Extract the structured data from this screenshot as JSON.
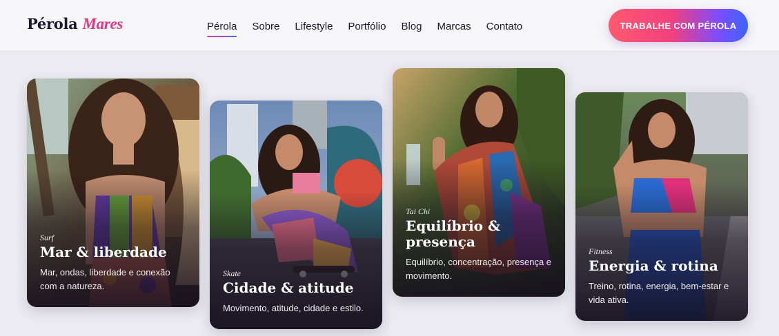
{
  "header": {
    "logo_main": "Pérola",
    "logo_accent": "Mares",
    "nav": [
      {
        "label": "Pérola",
        "active": true
      },
      {
        "label": "Sobre"
      },
      {
        "label": "Lifestyle"
      },
      {
        "label": "Portfólio"
      },
      {
        "label": "Blog"
      },
      {
        "label": "Marcas"
      },
      {
        "label": "Contato"
      }
    ],
    "cta_label": "TRABALHE COM PÉROLA"
  },
  "cards": [
    {
      "category": "Surf",
      "title": "Mar & liberdade",
      "description": "Mar, ondas, liberdade e conexão com a natureza."
    },
    {
      "category": "Skate",
      "title": "Cidade & atitude",
      "description": "Movimento, atitude, cidade e estilo."
    },
    {
      "category": "Tai Chi",
      "title": "Equilíbrio & presença",
      "description": "Equilíbrio, concentração, presença e movimento."
    },
    {
      "category": "Fitness",
      "title": "Energia & rotina",
      "description": "Treino, rotina, energia, bem-estar e vida ativa."
    }
  ],
  "colors": {
    "brand_pink": "#e8357f",
    "cta_gradient_start": "#ff5a6e",
    "cta_gradient_end": "#3a66ff",
    "background": "#ecebf1"
  }
}
